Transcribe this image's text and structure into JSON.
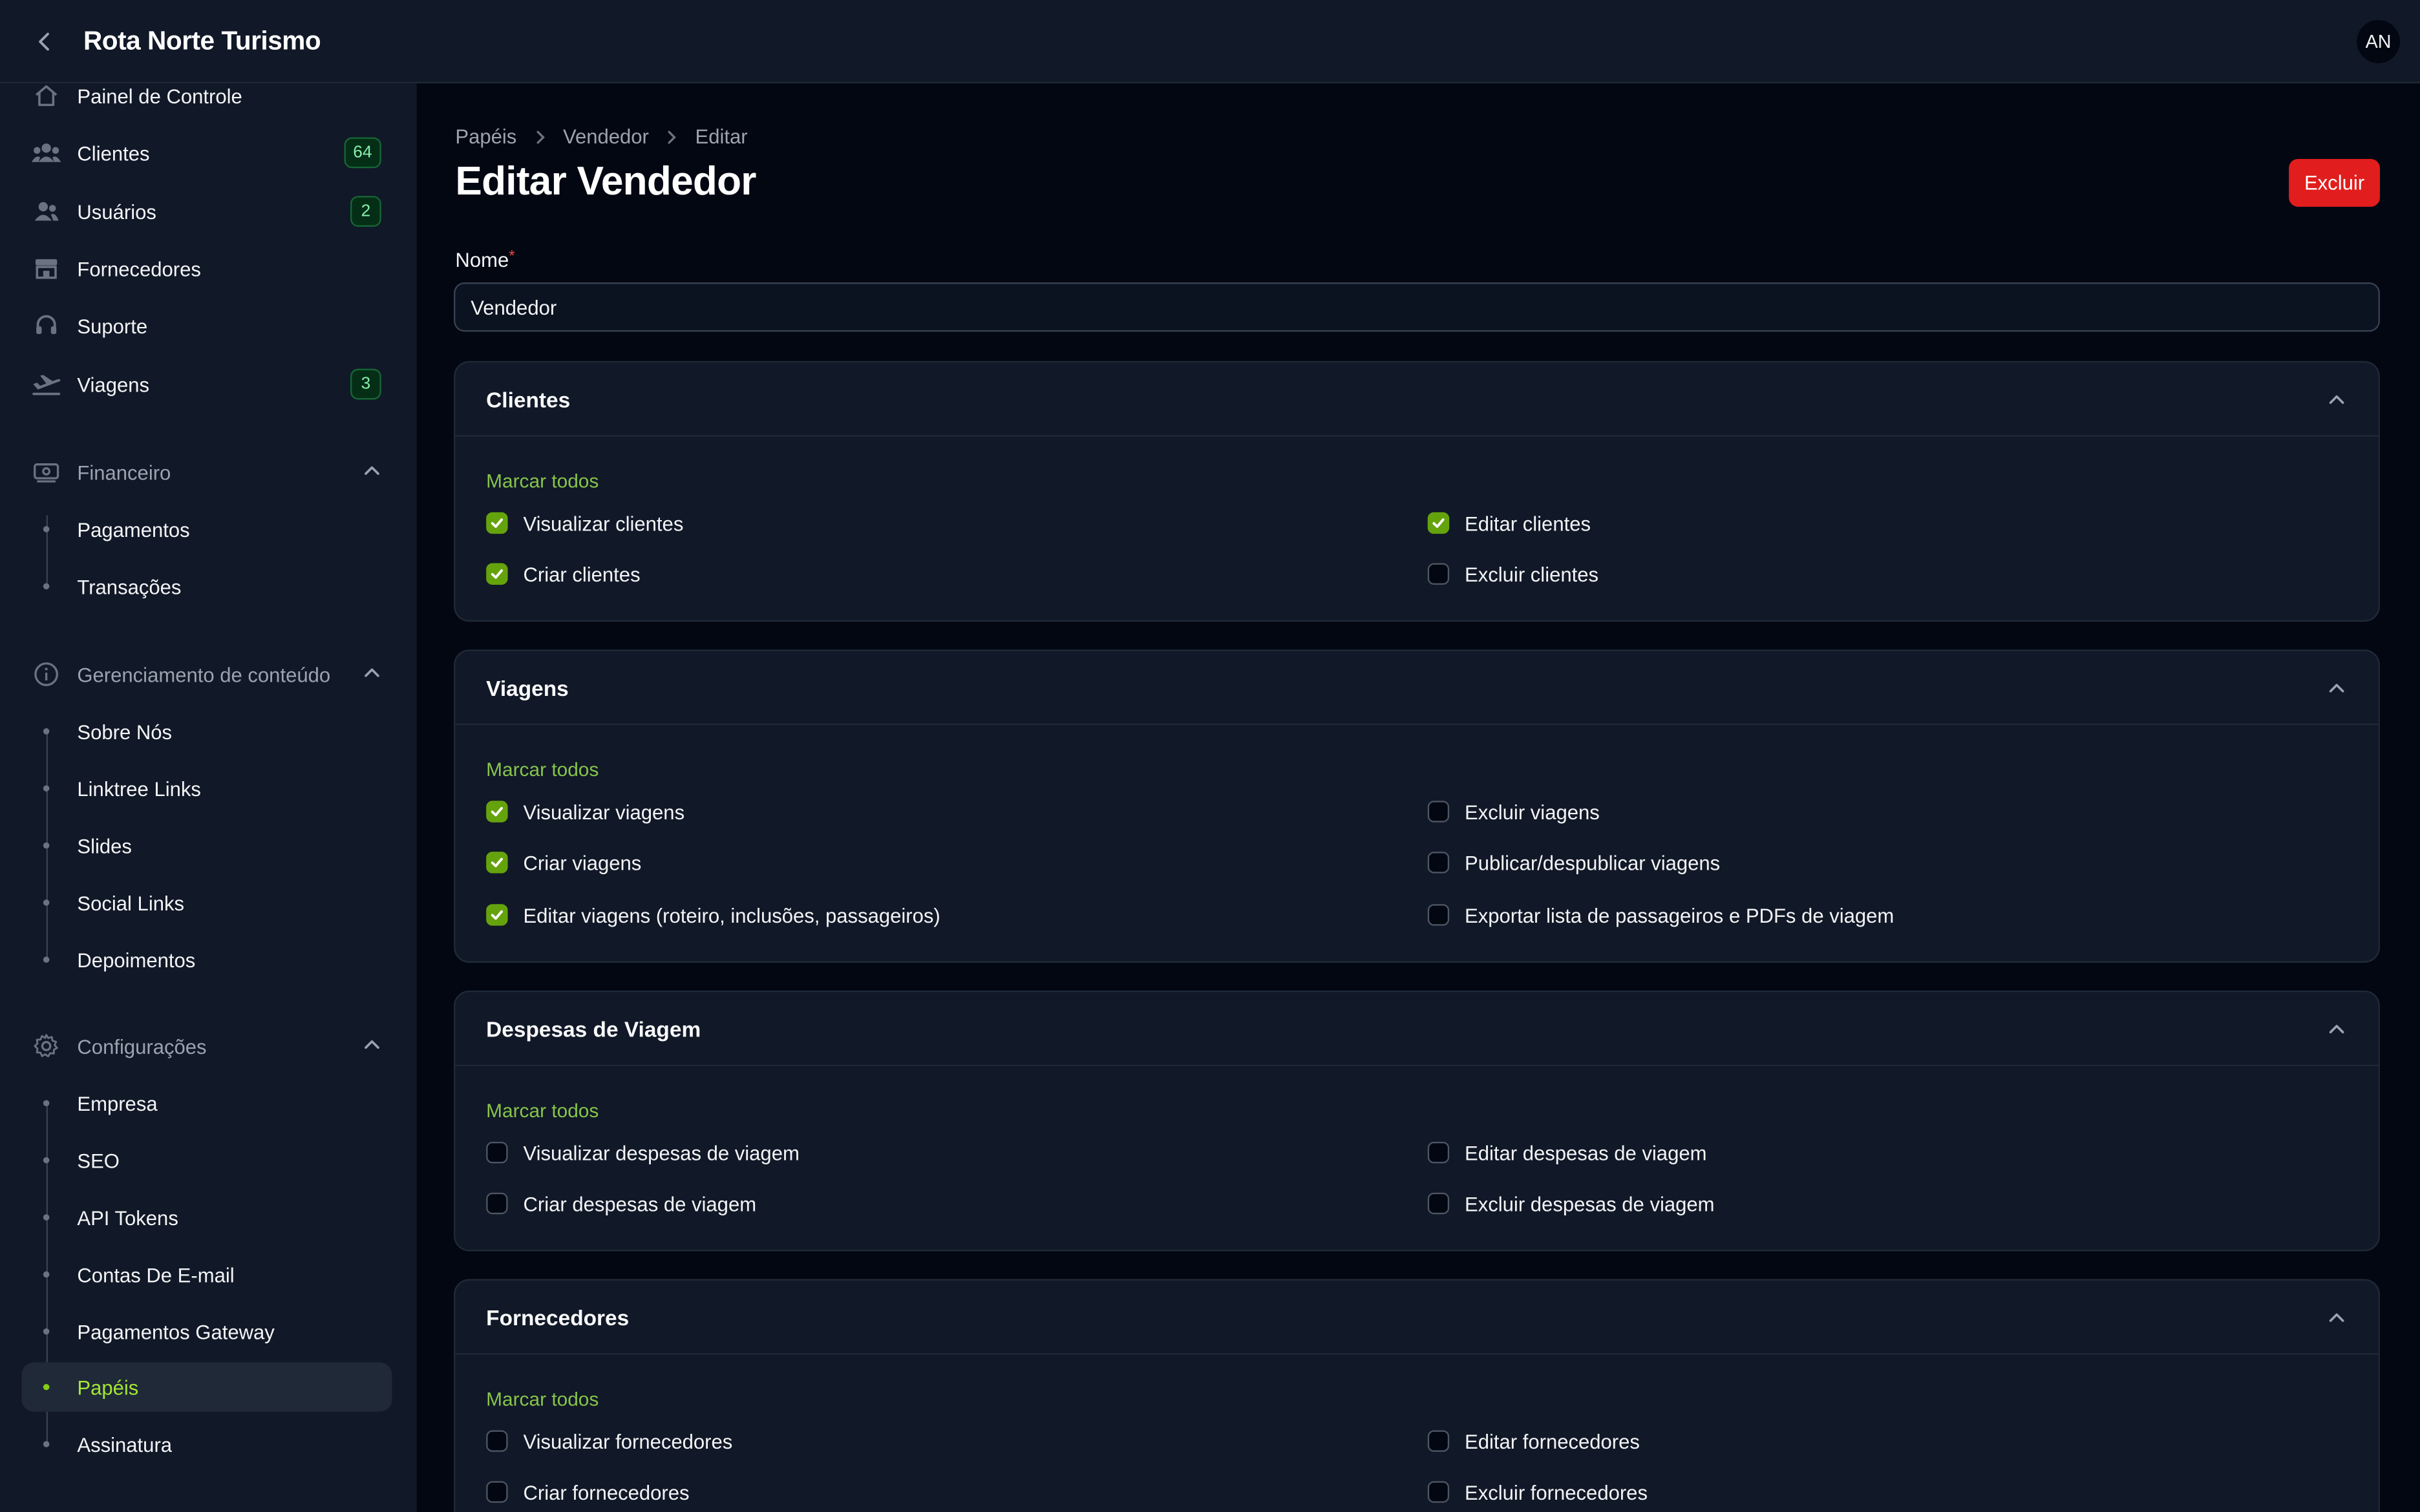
{
  "app": {
    "title": "Rota Norte Turismo",
    "avatar_initials": "AN"
  },
  "sidebar": {
    "items": [
      {
        "label": "Painel de Controle",
        "icon": "home-icon",
        "badge": null
      },
      {
        "label": "Clientes",
        "icon": "users-icon",
        "badge": "64"
      },
      {
        "label": "Usuários",
        "icon": "user-group-icon",
        "badge": "2"
      },
      {
        "label": "Fornecedores",
        "icon": "storefront-icon",
        "badge": null
      },
      {
        "label": "Suporte",
        "icon": "headset-icon",
        "badge": null
      },
      {
        "label": "Viagens",
        "icon": "plane-departure-icon",
        "badge": "3"
      }
    ],
    "groups": [
      {
        "label": "Financeiro",
        "icon": "banknote-icon",
        "items": [
          "Pagamentos",
          "Transações"
        ]
      },
      {
        "label": "Gerenciamento de conteúdo",
        "icon": "info-icon",
        "items": [
          "Sobre Nós",
          "Linktree Links",
          "Slides",
          "Social Links",
          "Depoimentos"
        ]
      },
      {
        "label": "Configurações",
        "icon": "cog-icon",
        "items": [
          "Empresa",
          "SEO",
          "API Tokens",
          "Contas De E-mail",
          "Pagamentos Gateway",
          "Papéis",
          "Assinatura"
        ],
        "active": "Papéis"
      }
    ]
  },
  "breadcrumb": [
    "Papéis",
    "Vendedor",
    "Editar"
  ],
  "page": {
    "title": "Editar Vendedor",
    "delete_label": "Excluir"
  },
  "form": {
    "name_label": "Nome",
    "required_mark": "*",
    "name_value": "Vendedor"
  },
  "mark_all_label": "Marcar todos",
  "sections": [
    {
      "title": "Clientes",
      "left": [
        {
          "label": "Visualizar clientes",
          "checked": true
        },
        {
          "label": "Criar clientes",
          "checked": true
        }
      ],
      "right": [
        {
          "label": "Editar clientes",
          "checked": true
        },
        {
          "label": "Excluir clientes",
          "checked": false
        }
      ]
    },
    {
      "title": "Viagens",
      "left": [
        {
          "label": "Visualizar viagens",
          "checked": true
        },
        {
          "label": "Criar viagens",
          "checked": true
        },
        {
          "label": "Editar viagens (roteiro, inclusões, passageiros)",
          "checked": true
        }
      ],
      "right": [
        {
          "label": "Excluir viagens",
          "checked": false
        },
        {
          "label": "Publicar/despublicar viagens",
          "checked": false
        },
        {
          "label": "Exportar lista de passageiros e PDFs de viagem",
          "checked": false
        }
      ]
    },
    {
      "title": "Despesas de Viagem",
      "left": [
        {
          "label": "Visualizar despesas de viagem",
          "checked": false
        },
        {
          "label": "Criar despesas de viagem",
          "checked": false
        }
      ],
      "right": [
        {
          "label": "Editar despesas de viagem",
          "checked": false
        },
        {
          "label": "Excluir despesas de viagem",
          "checked": false
        }
      ]
    },
    {
      "title": "Fornecedores",
      "left": [
        {
          "label": "Visualizar fornecedores",
          "checked": false
        },
        {
          "label": "Criar fornecedores",
          "checked": false
        }
      ],
      "right": [
        {
          "label": "Editar fornecedores",
          "checked": false
        },
        {
          "label": "Excluir fornecedores",
          "checked": false
        }
      ]
    }
  ],
  "colors": {
    "accent": "#84cc16",
    "danger": "#e11d1d",
    "badge_text": "#86efac",
    "background": "#030712",
    "panel": "#111827"
  }
}
